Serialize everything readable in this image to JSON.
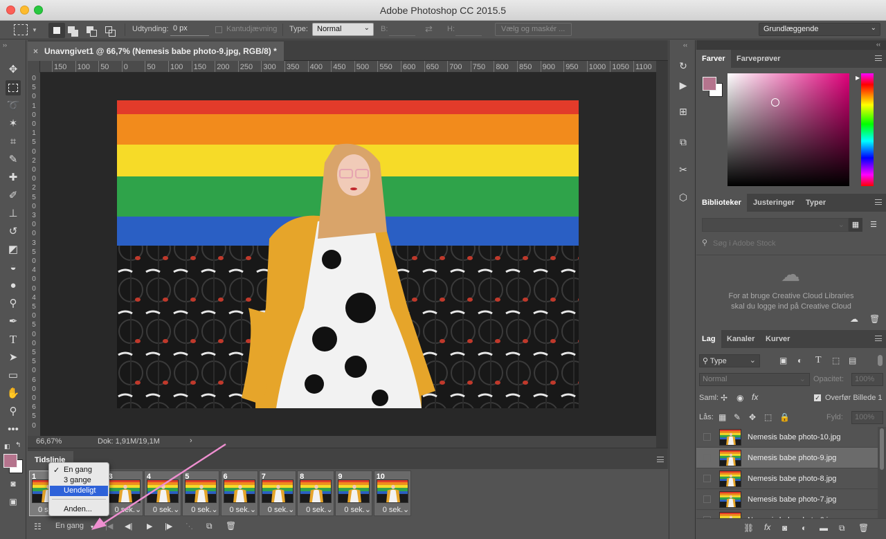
{
  "window": {
    "title": "Adobe Photoshop CC 2015.5"
  },
  "options": {
    "feather_label": "Udtynding:",
    "feather_value": "0 px",
    "antialias_label": "Kantudjævning",
    "type_label": "Type:",
    "type_value": "Normal",
    "width_label": "B:",
    "height_label": "H:",
    "select_mask_button": "Vælg og maskér ...",
    "workspace": "Grundlæggende"
  },
  "document": {
    "tab_title": "Unavngivet1 @ 66,7% (Nemesis babe photo-9.jpg, RGB/8) *",
    "zoom": "66,67%",
    "doc_info": "Dok: 1,91M/19,1M"
  },
  "ruler": {
    "h_ticks": [
      "150",
      "100",
      "50",
      "0",
      "50",
      "100",
      "150",
      "200",
      "250",
      "300",
      "350",
      "400",
      "450",
      "500",
      "550",
      "600",
      "650",
      "700",
      "750",
      "800",
      "850",
      "900",
      "950",
      "1000",
      "1050",
      "1100",
      "11"
    ],
    "v_ticks": [
      "0",
      "5",
      "0",
      "1",
      "0",
      "0",
      "1",
      "5",
      "0",
      "2",
      "0",
      "0",
      "2",
      "5",
      "0",
      "3",
      "0",
      "0",
      "3",
      "5",
      "0",
      "4",
      "0",
      "0",
      "4",
      "5",
      "0",
      "5",
      "0",
      "0",
      "5",
      "5",
      "0",
      "6",
      "0",
      "0",
      "6",
      "5",
      "0"
    ]
  },
  "timeline": {
    "title": "Tidslinje",
    "frames": [
      {
        "num": "1",
        "delay": "0 sek."
      },
      {
        "num": "2",
        "delay": "0 sek."
      },
      {
        "num": "3",
        "delay": "0 sek."
      },
      {
        "num": "4",
        "delay": "0 sek."
      },
      {
        "num": "5",
        "delay": "0 sek."
      },
      {
        "num": "6",
        "delay": "0 sek."
      },
      {
        "num": "7",
        "delay": "0 sek."
      },
      {
        "num": "8",
        "delay": "0 sek."
      },
      {
        "num": "9",
        "delay": "0 sek."
      },
      {
        "num": "10",
        "delay": "0 sek."
      }
    ],
    "loop_value": "En gang",
    "loop_menu": [
      "En gang",
      "3 gange",
      "Uendeligt",
      "Anden..."
    ]
  },
  "color_panel": {
    "tabs": [
      "Farver",
      "Farveprøver"
    ],
    "foreground": "#b5748d",
    "background": "#ffffff"
  },
  "libraries_panel": {
    "tabs": [
      "Biblioteker",
      "Justeringer",
      "Typer"
    ],
    "search_placeholder": "Søg i Adobe Stock",
    "message_line1": "For at bruge Creative Cloud Libraries",
    "message_line2": "skal du logge ind på Creative Cloud"
  },
  "layers_panel": {
    "tabs": [
      "Lag",
      "Kanaler",
      "Kurver"
    ],
    "filter_kind": "Type",
    "blend_mode": "Normal",
    "opacity_label": "Opacitet:",
    "opacity_value": "100%",
    "unify_label": "Saml:",
    "propagate_label": "Overfør Billede 1",
    "lock_label": "Lås:",
    "fill_label": "Fyld:",
    "fill_value": "100%",
    "layers": [
      {
        "name": "Nemesis babe photo-10.jpg",
        "selected": false
      },
      {
        "name": "Nemesis babe photo-9.jpg",
        "selected": true
      },
      {
        "name": "Nemesis babe photo-8.jpg",
        "selected": false
      },
      {
        "name": "Nemesis babe photo-7.jpg",
        "selected": false
      },
      {
        "name": "Nemesis babe photo-6.jpg",
        "selected": false
      }
    ]
  }
}
